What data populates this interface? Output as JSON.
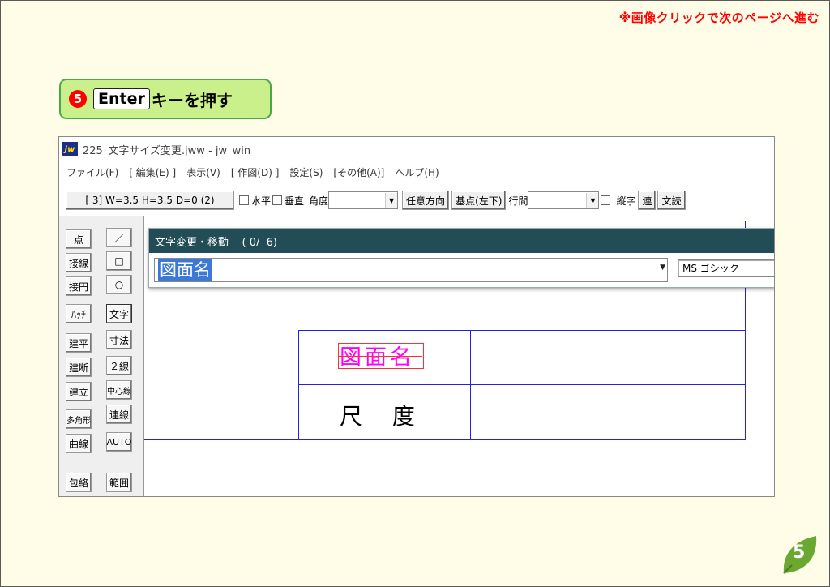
{
  "hint_text": "※画像クリックで次のページへ進む",
  "step": {
    "number": "5",
    "key_label": "Enter",
    "text": "キーを押す"
  },
  "window": {
    "icon_label": "jw",
    "title": "225_文字サイズ変更.jww - jw_win",
    "menu": [
      "ファイル(F)",
      "[ 編集(E) ]",
      "表示(V)",
      "[ 作図(D) ]",
      "設定(S)",
      "[その他(A)]",
      "ヘルプ(H)"
    ]
  },
  "toolbar": {
    "size_label": "[ 3]  W=3.5  H=3.5  D=0 (2)",
    "horizontal": "水平",
    "vertical": "垂直",
    "angle": "角度",
    "arbitrary": "任意方向",
    "basepoint": "基点(左下)",
    "line_spacing": "行間",
    "vertical_text": "縦字",
    "ren": "連",
    "bun_yomi": "文読"
  },
  "sidebar_left": [
    "点",
    "接線",
    "接円",
    "ﾊｯﾁ",
    "建平",
    "建断",
    "建立",
    "多角形",
    "曲線",
    "包絡"
  ],
  "sidebar_right": [
    "／",
    "□",
    "○",
    "文字",
    "寸法",
    "２線",
    "中心線",
    "連線",
    "AUTO",
    "範囲"
  ],
  "dialog": {
    "title": "文字変更・移動    ( 0/  6)",
    "input_value": "図面名",
    "font": "MS ゴシック"
  },
  "drawing": {
    "cell_a": "図面名",
    "cell_b": "尺　 度"
  },
  "page_number": "5",
  "colors": {
    "hint": "#ff0000",
    "step_bg": "#c9f08a",
    "dialog_title": "#234d56",
    "grid_line": "#2323d9",
    "badge": "#6aa832"
  }
}
